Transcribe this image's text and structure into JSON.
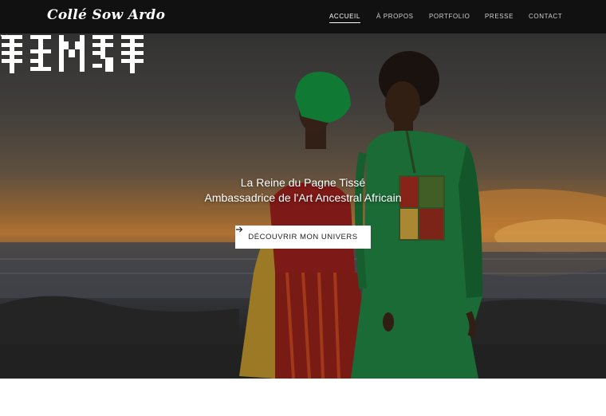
{
  "header": {
    "logo": "Collé Sow Ardo",
    "nav": [
      {
        "label": "ACCUEIL",
        "active": true
      },
      {
        "label": "À PROPOS",
        "active": false
      },
      {
        "label": "PORTFOLIO",
        "active": false
      },
      {
        "label": "PRESSE",
        "active": false
      },
      {
        "label": "CONTACT",
        "active": false
      }
    ]
  },
  "hero": {
    "emblem_icon": "woven-pattern-emblem-icon",
    "tagline_line1": "La Reine du Pagne Tissé",
    "tagline_line2": "Ambassadrice de l'Art Ancestral Africain",
    "cta_label": "DÉCOUVRIR MON UNIVERS",
    "cta_icon": "arrow-right-icon",
    "scroll_icon": "chevron-down-icon"
  },
  "colors": {
    "header_bg": "#111111",
    "text_light": "#ffffff",
    "cta_bg": "#ffffff",
    "cta_text": "#222222",
    "green_garment": "#1f7a3e",
    "red_garment": "#8f1d1a"
  }
}
